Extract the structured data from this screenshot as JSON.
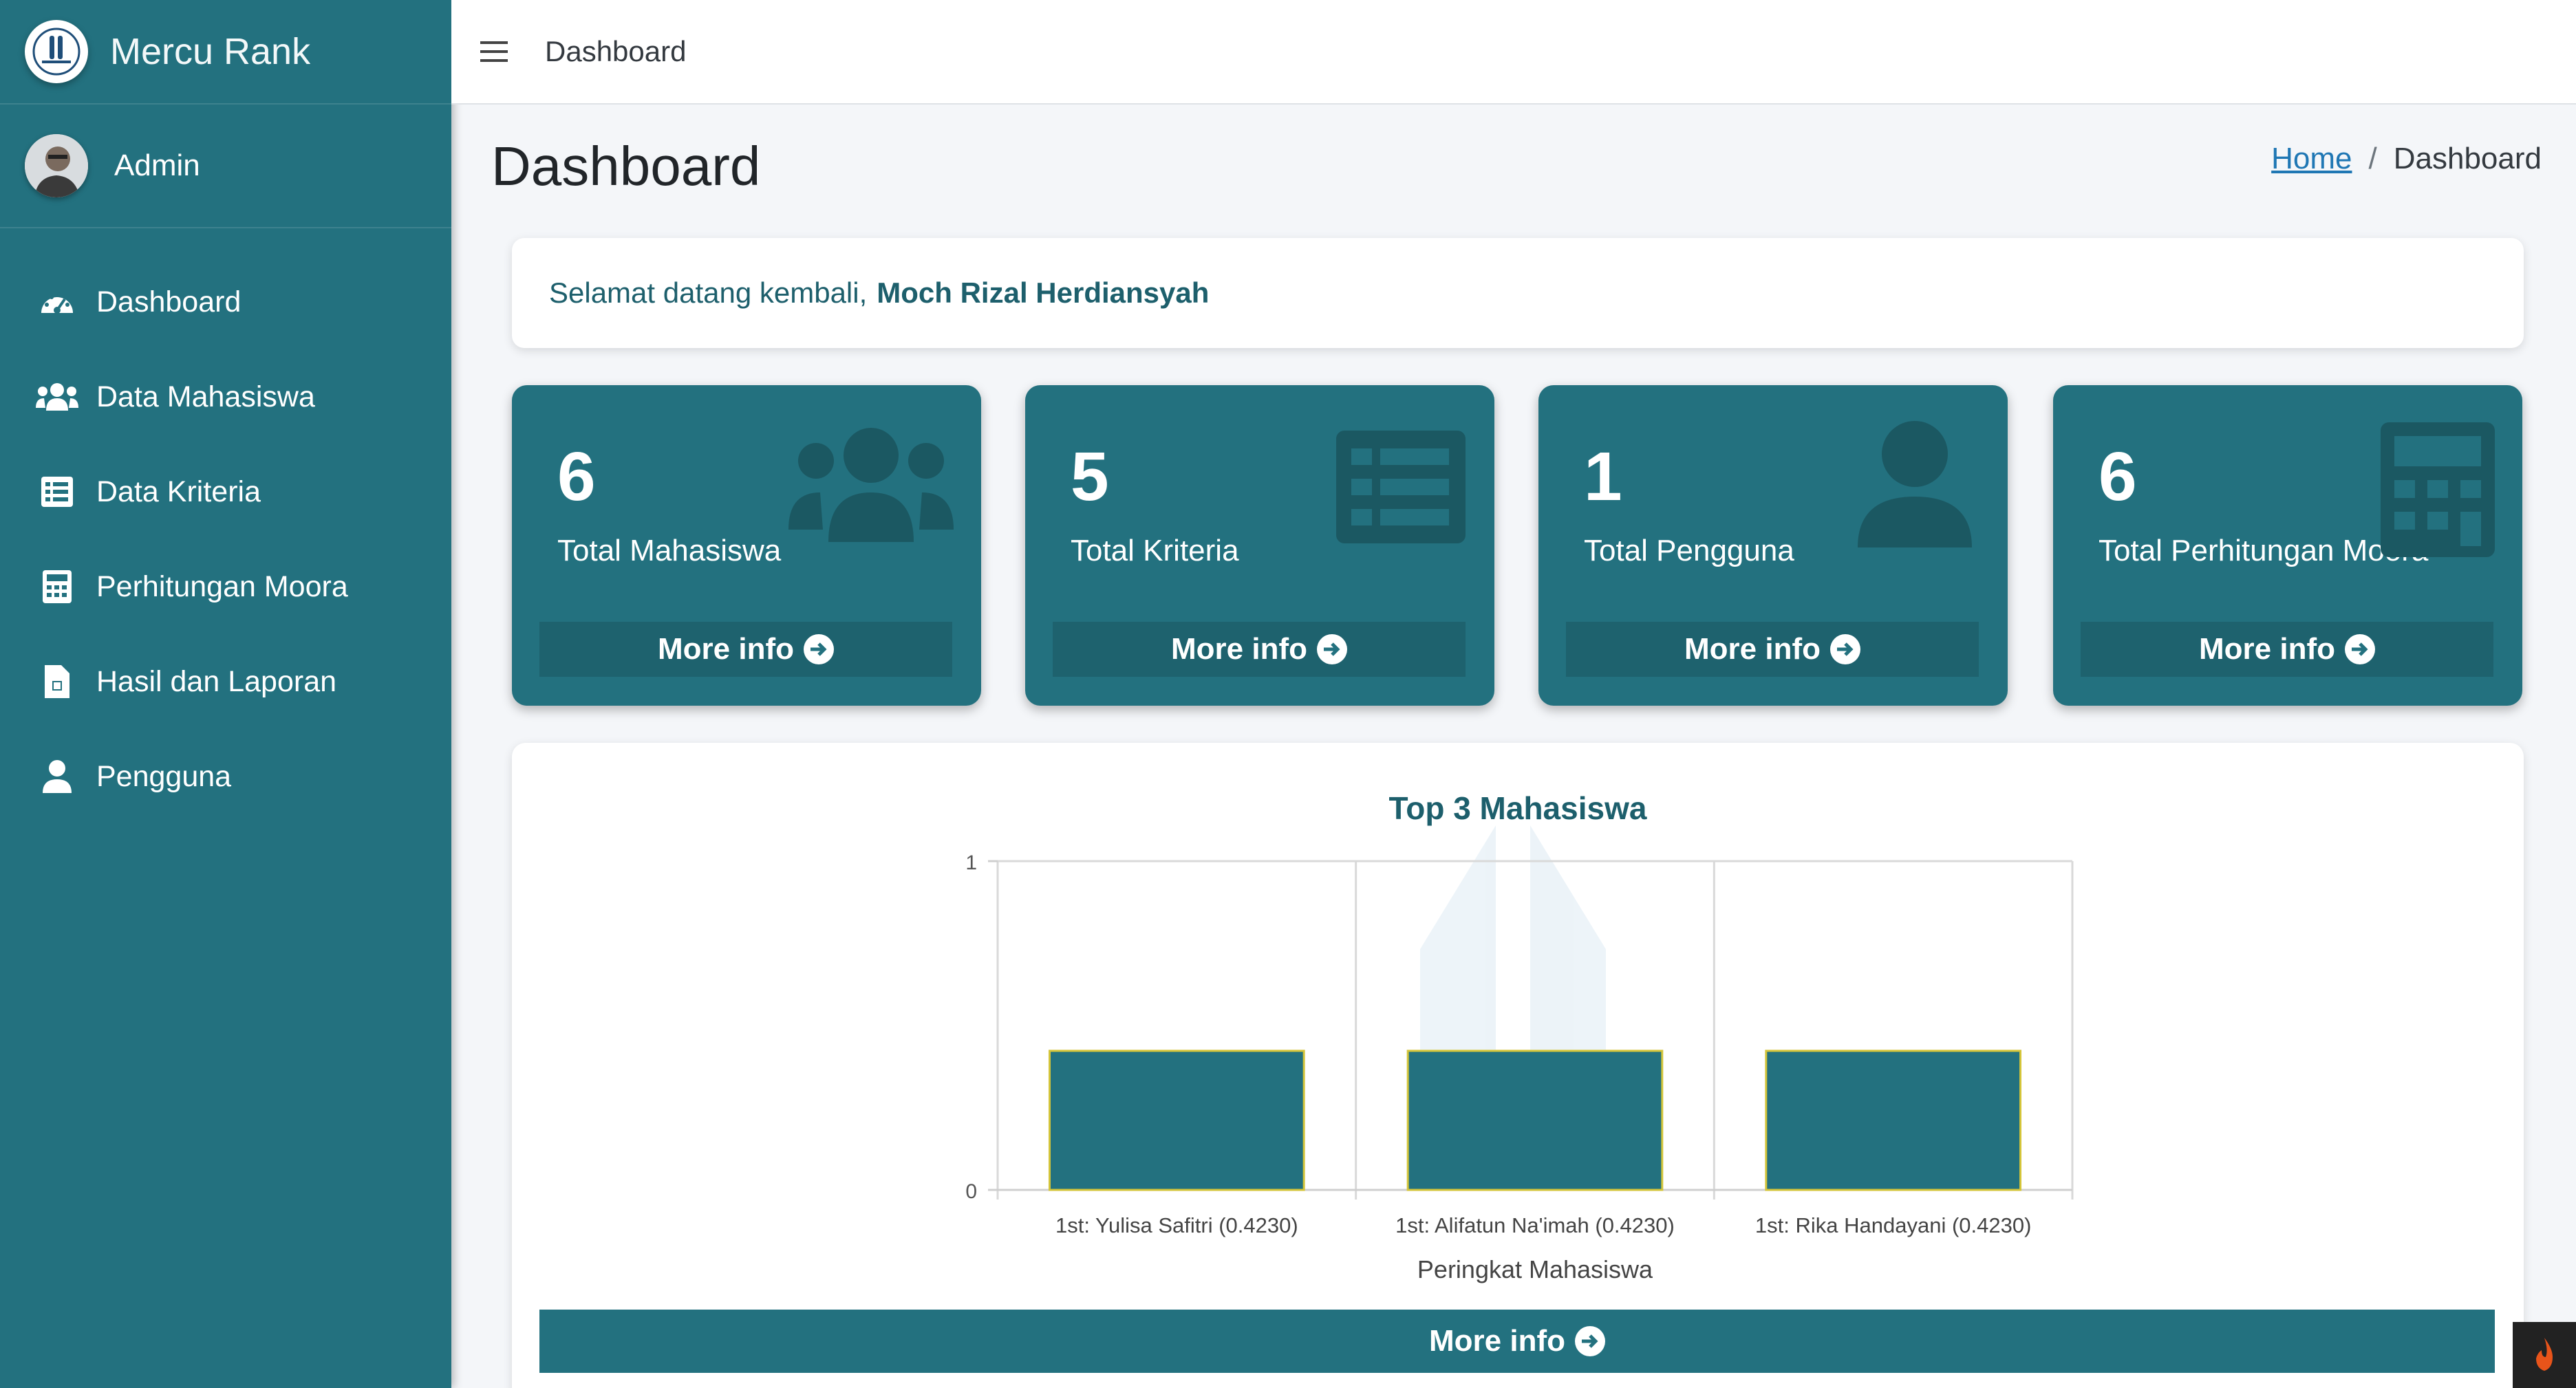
{
  "app": {
    "brand": "Mercu Rank"
  },
  "user": {
    "name": "Admin"
  },
  "sidebar": {
    "items": [
      {
        "label": "Dashboard",
        "icon": "tachometer-icon"
      },
      {
        "label": "Data Mahasiswa",
        "icon": "users-icon"
      },
      {
        "label": "Data Kriteria",
        "icon": "list-icon"
      },
      {
        "label": "Perhitungan Moora",
        "icon": "calculator-icon"
      },
      {
        "label": "Hasil dan Laporan",
        "icon": "file-icon"
      },
      {
        "label": "Pengguna",
        "icon": "user-icon"
      }
    ]
  },
  "header": {
    "title": "Dashboard"
  },
  "page": {
    "title": "Dashboard",
    "breadcrumb": {
      "home": "Home",
      "sep": "/",
      "current": "Dashboard"
    }
  },
  "welcome": {
    "prefix": "Selamat datang kembali,",
    "name": "Moch Rizal Herdiansyah"
  },
  "boxes": [
    {
      "value": "6",
      "label": "Total Mahasiswa",
      "more": "More info",
      "icon": "users-icon"
    },
    {
      "value": "5",
      "label": "Total Kriteria",
      "more": "More info",
      "icon": "list-icon"
    },
    {
      "value": "1",
      "label": "Total Pengguna",
      "more": "More info",
      "icon": "user-icon"
    },
    {
      "value": "6",
      "label": "Total Perhitungan Moora",
      "more": "More info",
      "icon": "calculator-icon"
    }
  ],
  "colors": {
    "primary": "#23717f",
    "bar_border": "#d4c53a"
  },
  "chart_more": "More info",
  "chart_data": {
    "type": "bar",
    "title": "Top 3 Mahasiswa",
    "xlabel": "Peringkat Mahasiswa",
    "ylabel": "",
    "categories": [
      "1st: Yulisa Safitri (0.4230)",
      "1st: Alifatun Na'imah (0.4230)",
      "1st: Rika Handayani (0.4230)"
    ],
    "values": [
      0.423,
      0.423,
      0.423
    ],
    "ylim": [
      0,
      1
    ],
    "yticks": [
      "0",
      "1"
    ],
    "grid": true,
    "legend": "none"
  }
}
